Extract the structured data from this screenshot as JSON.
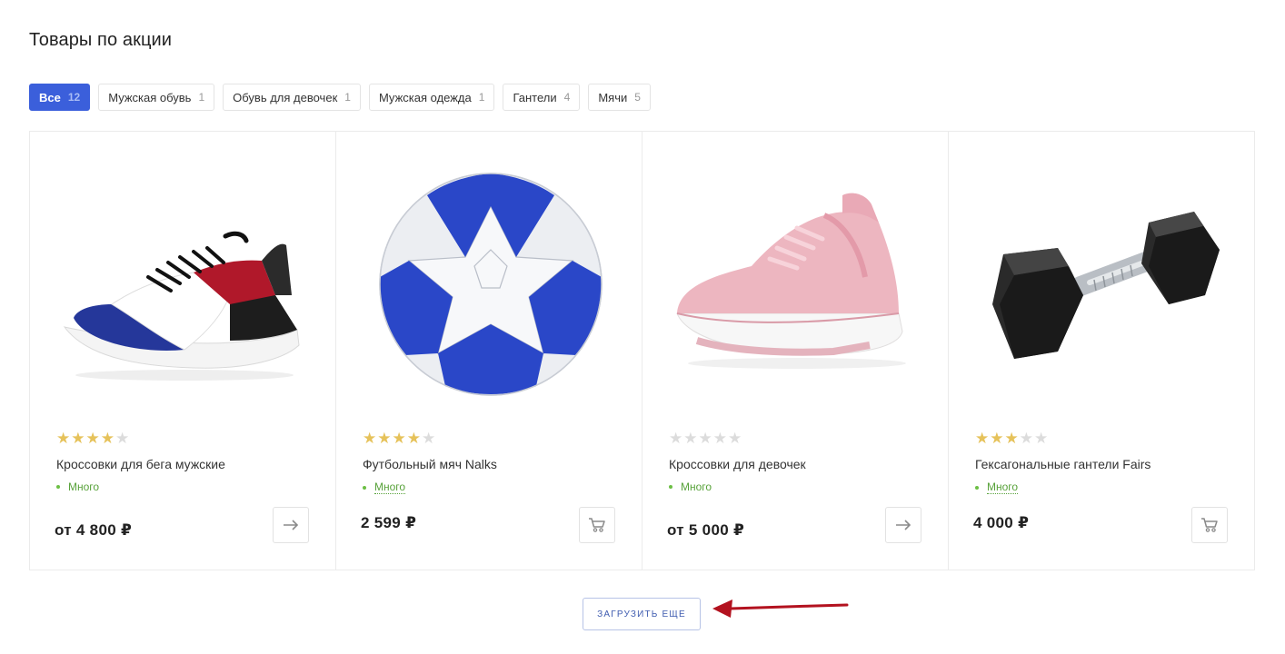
{
  "section": {
    "title": "Товары по акции"
  },
  "tabs": [
    {
      "label": "Все",
      "count": "12",
      "active": true
    },
    {
      "label": "Мужская обувь",
      "count": "1"
    },
    {
      "label": "Обувь для девочек",
      "count": "1"
    },
    {
      "label": "Мужская одежда",
      "count": "1"
    },
    {
      "label": "Гантели",
      "count": "4"
    },
    {
      "label": "Мячи",
      "count": "5"
    }
  ],
  "products": [
    {
      "title": "Кроссовки для бега мужские",
      "rating": 4,
      "stock": "Много",
      "price": "от 4 800 ₽",
      "action": "arrow-icon",
      "image": "running-shoe-image"
    },
    {
      "title": "Футбольный мяч Nalks",
      "rating": 4,
      "stock": "Много",
      "price": "2 599 ₽",
      "action": "cart-icon",
      "image": "soccer-ball-image"
    },
    {
      "title": "Кроссовки для девочек",
      "rating": 0,
      "stock": "Много",
      "price": "от 5 000 ₽",
      "action": "arrow-icon",
      "image": "pink-sneaker-image"
    },
    {
      "title": "Гексагональные гантели Fairs",
      "rating": 3,
      "stock": "Много",
      "price": "4 000 ₽",
      "action": "cart-icon",
      "image": "hex-dumbbell-image"
    }
  ],
  "load_more": {
    "label": "ЗАГРУЗИТЬ ЕЩЕ"
  },
  "colors": {
    "accent": "#3b5fdb",
    "star": "#e6c25a",
    "stock": "#58a23a",
    "annotation": "#b3121f"
  }
}
